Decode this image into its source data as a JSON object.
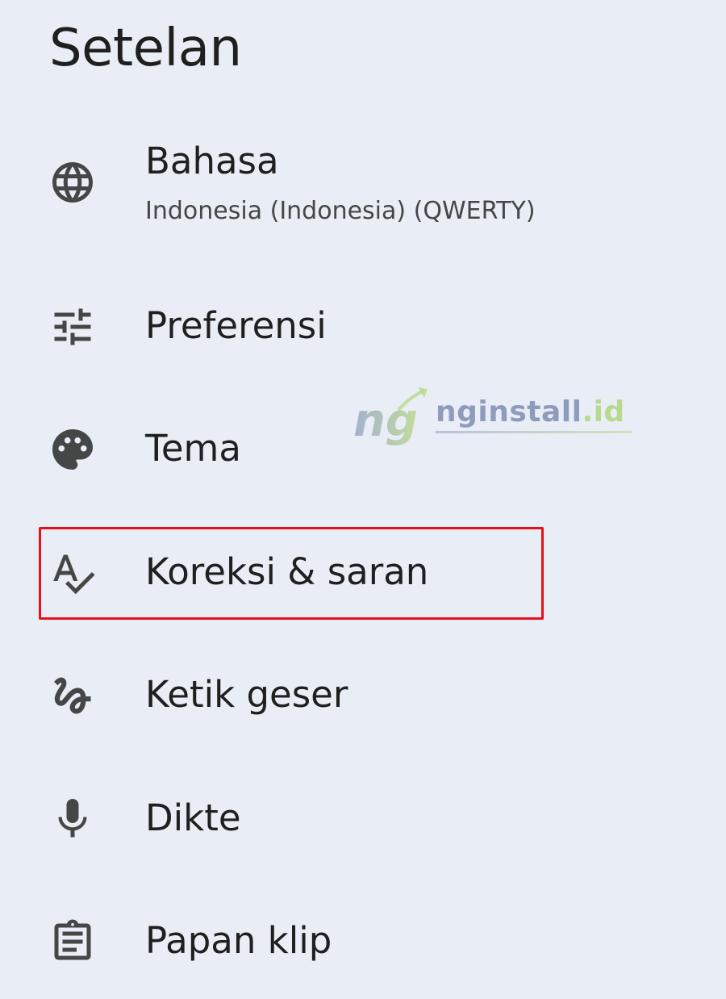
{
  "header": {
    "title": "Setelan"
  },
  "items": [
    {
      "id": "bahasa",
      "label": "Bahasa",
      "sublabel": "Indonesia (Indonesia) (QWERTY)",
      "icon": "globe-icon"
    },
    {
      "id": "preferensi",
      "label": "Preferensi",
      "icon": "tune-sliders-icon"
    },
    {
      "id": "tema",
      "label": "Tema",
      "icon": "palette-icon"
    },
    {
      "id": "koreksi",
      "label": "Koreksi & saran",
      "icon": "spellcheck-icon",
      "highlighted": true
    },
    {
      "id": "ketik-geser",
      "label": "Ketik geser",
      "icon": "gesture-icon"
    },
    {
      "id": "dikte",
      "label": "Dikte",
      "icon": "microphone-icon"
    },
    {
      "id": "papan-klip",
      "label": "Papan klip",
      "icon": "clipboard-icon"
    }
  ],
  "watermark": {
    "logo_letters": "ng",
    "brand": "nginstall",
    "tld": ".id"
  },
  "colors": {
    "background": "#e9eef6",
    "text_primary": "#1f1f1f",
    "text_secondary": "#444746",
    "icon": "#444746",
    "highlight": "#e8101a"
  }
}
